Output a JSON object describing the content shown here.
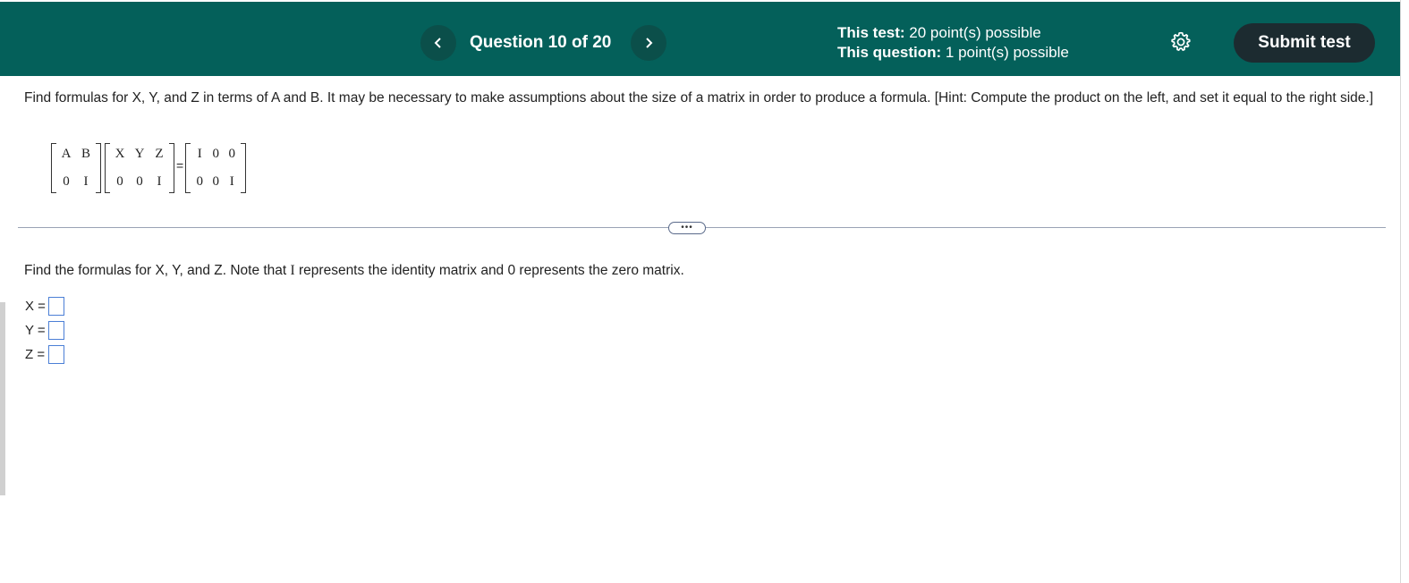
{
  "header": {
    "prev_icon": "chevron-left-icon",
    "next_icon": "chevron-right-icon",
    "question_label": "Question 10 of 20",
    "test_points_label": "This test:",
    "test_points_value": " 20 point(s) possible",
    "question_points_label": "This question:",
    "question_points_value": " 1 point(s) possible",
    "settings_icon": "gear-icon",
    "submit_label": "Submit test",
    "colors": {
      "bar": "#04605a",
      "nav_button": "#0b4f4a",
      "submit": "#1c2b30"
    }
  },
  "problem": {
    "prompt": "Find formulas for X, Y, and Z in terms of A and B. It may be necessary to make assumptions about the size of a matrix in order to produce a formula. [Hint: Compute the product on the left, and set it equal to the right side.]",
    "matrix_left": [
      [
        "A",
        "B"
      ],
      [
        "0",
        "I"
      ]
    ],
    "matrix_middle": [
      [
        "X",
        "Y",
        "Z"
      ],
      [
        "0",
        "0",
        "I"
      ]
    ],
    "equals": "=",
    "matrix_right": [
      [
        "I",
        "0",
        "0"
      ],
      [
        "0",
        "0",
        "I"
      ]
    ],
    "expander_label": "•••"
  },
  "answer": {
    "prompt_part1": "Find the formulas for X, Y, and Z. Note that ",
    "prompt_identity": "I",
    "prompt_part2": " represents the identity matrix and 0 represents the zero matrix.",
    "rows": [
      {
        "label": "X =",
        "value": ""
      },
      {
        "label": "Y =",
        "value": ""
      },
      {
        "label": "Z =",
        "value": ""
      }
    ]
  }
}
